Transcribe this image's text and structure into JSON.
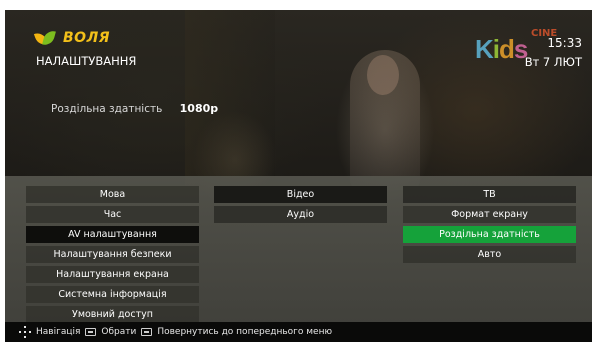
{
  "brand": {
    "name": "ВОЛЯ",
    "colors": {
      "leaf_left": "#f3b512",
      "leaf_right": "#7dbd1f",
      "text": "#f3c01a"
    }
  },
  "header": {
    "title": "НАЛАШТУВАННЯ"
  },
  "channel": {
    "logo_main": "Kids",
    "logo_sub": "CINE"
  },
  "status": {
    "time": "15:33",
    "date": "Вт 7 ЛЮТ"
  },
  "current_setting": {
    "label": "Роздільна здатність",
    "value": "1080p"
  },
  "menu": {
    "main_items": [
      {
        "label": "Мова"
      },
      {
        "label": "Час"
      },
      {
        "label": "AV налаштування",
        "active": true
      },
      {
        "label": "Налаштування безпеки"
      },
      {
        "label": "Налаштування екрана"
      },
      {
        "label": "Системна інформація"
      },
      {
        "label": "Умовний доступ"
      }
    ],
    "sub_items": [
      {
        "label": "Відео",
        "active": true
      },
      {
        "label": "Аудіо"
      }
    ],
    "options": [
      {
        "label": "ТВ"
      },
      {
        "label": "Формат екрану"
      },
      {
        "label": "Роздільна здатність",
        "selected": true
      },
      {
        "label": "Авто"
      }
    ],
    "selected_color": "#15a23a"
  },
  "footer": {
    "nav_icon": "dpad-icon",
    "navigation_label": "Навігація",
    "ok_icon": "ok-key-icon",
    "select_label": "Обрати",
    "back_icon": "back-key-icon",
    "back_label": "Повернутись до попереднього меню"
  }
}
